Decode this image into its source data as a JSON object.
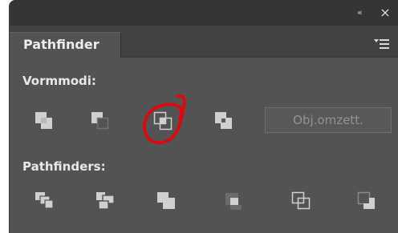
{
  "titlebar": {
    "collapse_glyph": "«",
    "close_glyph": "×",
    "icons": [
      "collapse-icon",
      "close-icon"
    ]
  },
  "panel": {
    "tab_label": "Pathfinder",
    "menu_icon": "panel-menu-icon"
  },
  "shape_modes": {
    "label": "Vormmodi:",
    "buttons": [
      {
        "icon": "unite-icon"
      },
      {
        "icon": "minus-front-icon"
      },
      {
        "icon": "intersect-icon"
      },
      {
        "icon": "exclude-icon"
      }
    ],
    "convert_label": "Obj.omzett."
  },
  "pathfinders": {
    "label": "Pathfinders:",
    "buttons": [
      {
        "icon": "divide-icon"
      },
      {
        "icon": "trim-icon"
      },
      {
        "icon": "merge-icon"
      },
      {
        "icon": "crop-icon"
      },
      {
        "icon": "outline-icon"
      },
      {
        "icon": "minus-back-icon"
      }
    ]
  },
  "annotation": {
    "highlight_color": "#e8000a",
    "highlighted_button": "intersect-icon"
  },
  "colors": {
    "panel_bg": "#535353",
    "titlebar_bg": "#353535",
    "icon_light": "#d0d0d0",
    "icon_dark": "#6b6b6b"
  }
}
